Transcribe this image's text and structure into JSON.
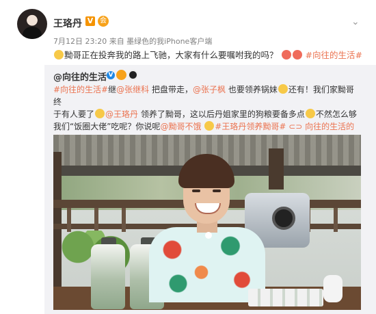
{
  "post": {
    "user_name": "王珞丹",
    "vip_label": "V",
    "meta": "7月12日 23:20 来自 墨绿色的我iPhone客户端",
    "text_a": "黝哥正在投奔我的路上飞驰，大家有什么要嘱咐我的吗？",
    "hashtag": "#向往的生活#"
  },
  "repost": {
    "user_name": "@向往的生活",
    "v_label": "V",
    "line1_tag": "#向往的生活#",
    "line1_b": "继",
    "mention_zhang": "@张继科",
    "line1_c": "把盘带走，",
    "mention_zhang2": "@张子枫",
    "line1_d": "也要领养锅妹",
    "line1_e": "还有！我们家黝哥终",
    "line2_a": "于有人要了",
    "mention_wang": "@王珞丹",
    "line2_b": "领养了黝哥，这以后丹姐家里的狗粮要备多点",
    "line2_c": "不然怎么够",
    "line3_a": "我们“饭圈大佬”吃呢？你说呢",
    "mention_dogbro": "@黝哥不饿",
    "tag2": "#王珞丹领养黝哥#",
    "video_link": "向往的生活的微博视频"
  },
  "icons": {
    "more": "chevron-down-icon",
    "video": "video-link-icon"
  },
  "colors": {
    "link": "#eb7350",
    "repost_bg": "#f2f2f5",
    "meta": "#808080"
  }
}
